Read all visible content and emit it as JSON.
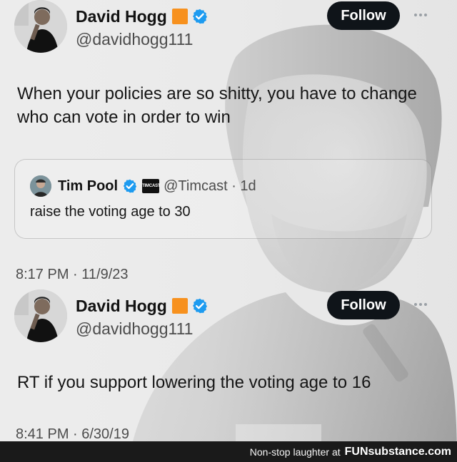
{
  "tweet1": {
    "name": "David Hogg",
    "handle": "@davidhogg111",
    "follow_label": "Follow",
    "text": "When your policies are so shitty, you have to change who can vote in order to win",
    "timestamp": "8:17 PM · 11/9/23"
  },
  "quote": {
    "name": "Tim Pool",
    "badge": "TIMCAST",
    "handle_time": "@Timcast · 1d",
    "text": "raise the voting age to 30"
  },
  "tweet2": {
    "name": "David Hogg",
    "handle": "@davidhogg111",
    "follow_label": "Follow",
    "text": "RT if you support lowering the voting age to 16",
    "timestamp": "8:41 PM · 6/30/19"
  },
  "footer": {
    "text": "Non-stop laughter at",
    "brand": "FUNsubstance.com"
  },
  "colors": {
    "verified": "#1d9bf0",
    "badge_orange": "#f7911e",
    "follow_bg": "#0f1419"
  },
  "icons": {
    "verified": "verified-badge-icon",
    "more": "more-options-icon"
  }
}
